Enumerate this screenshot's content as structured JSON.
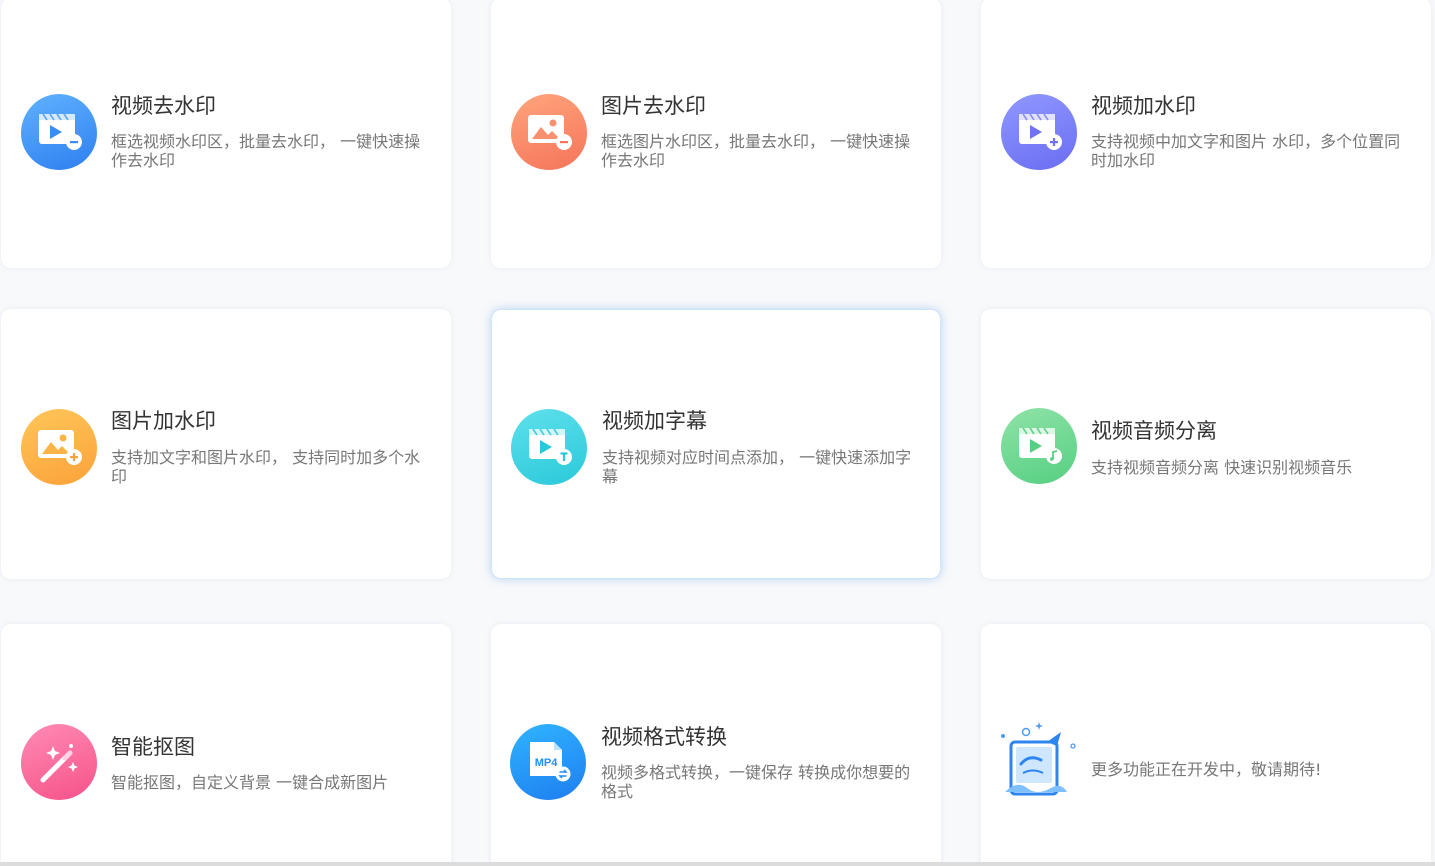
{
  "cards": [
    {
      "title": "视频去水印",
      "desc": "框选视频水印区，批量去水印， 一键快速操作去水印",
      "icon": "video-remove-watermark-icon",
      "color_top": "#5fb2ff",
      "color_bottom": "#2f7ff0"
    },
    {
      "title": "图片去水印",
      "desc": "框选图片水印区，批量去水印， 一键快速操作去水印",
      "icon": "image-remove-watermark-icon",
      "color_top": "#ffa57c",
      "color_bottom": "#f5745a"
    },
    {
      "title": "视频加水印",
      "desc": "支持视频中加文字和图片 水印，多个位置同时加水印",
      "icon": "video-add-watermark-icon",
      "color_top": "#9098ff",
      "color_bottom": "#6a6df2"
    },
    {
      "title": "图片加水印",
      "desc": "支持加文字和图片水印， 支持同时加多个水印",
      "icon": "image-add-watermark-icon",
      "color_top": "#ffc659",
      "color_bottom": "#fba23a"
    },
    {
      "title": "视频加字幕",
      "desc": "支持视频对应时间点添加， 一键快速添加字幕",
      "icon": "video-add-subtitle-icon",
      "color_top": "#5fe0ec",
      "color_bottom": "#2ac9da"
    },
    {
      "title": "视频音频分离",
      "desc": "支持视频音频分离 快速识别视频音乐",
      "icon": "video-audio-separate-icon",
      "color_top": "#8fe3a7",
      "color_bottom": "#56cf82"
    },
    {
      "title": "智能抠图",
      "desc": "智能抠图，自定义背景 一键合成新图片",
      "icon": "magic-wand-icon",
      "color_top": "#ff8bb4",
      "color_bottom": "#f65289"
    },
    {
      "title": "视频格式转换",
      "desc": "视频多格式转换，一键保存 转换成你想要的格式",
      "icon": "mp4-convert-icon",
      "icon_text": "MP4",
      "color_top": "#30b4ff",
      "color_bottom": "#1e7ef0"
    },
    {
      "title": "",
      "desc": "更多功能正在开发中，敬请期待!",
      "icon": "coming-soon-illustration-icon"
    }
  ]
}
